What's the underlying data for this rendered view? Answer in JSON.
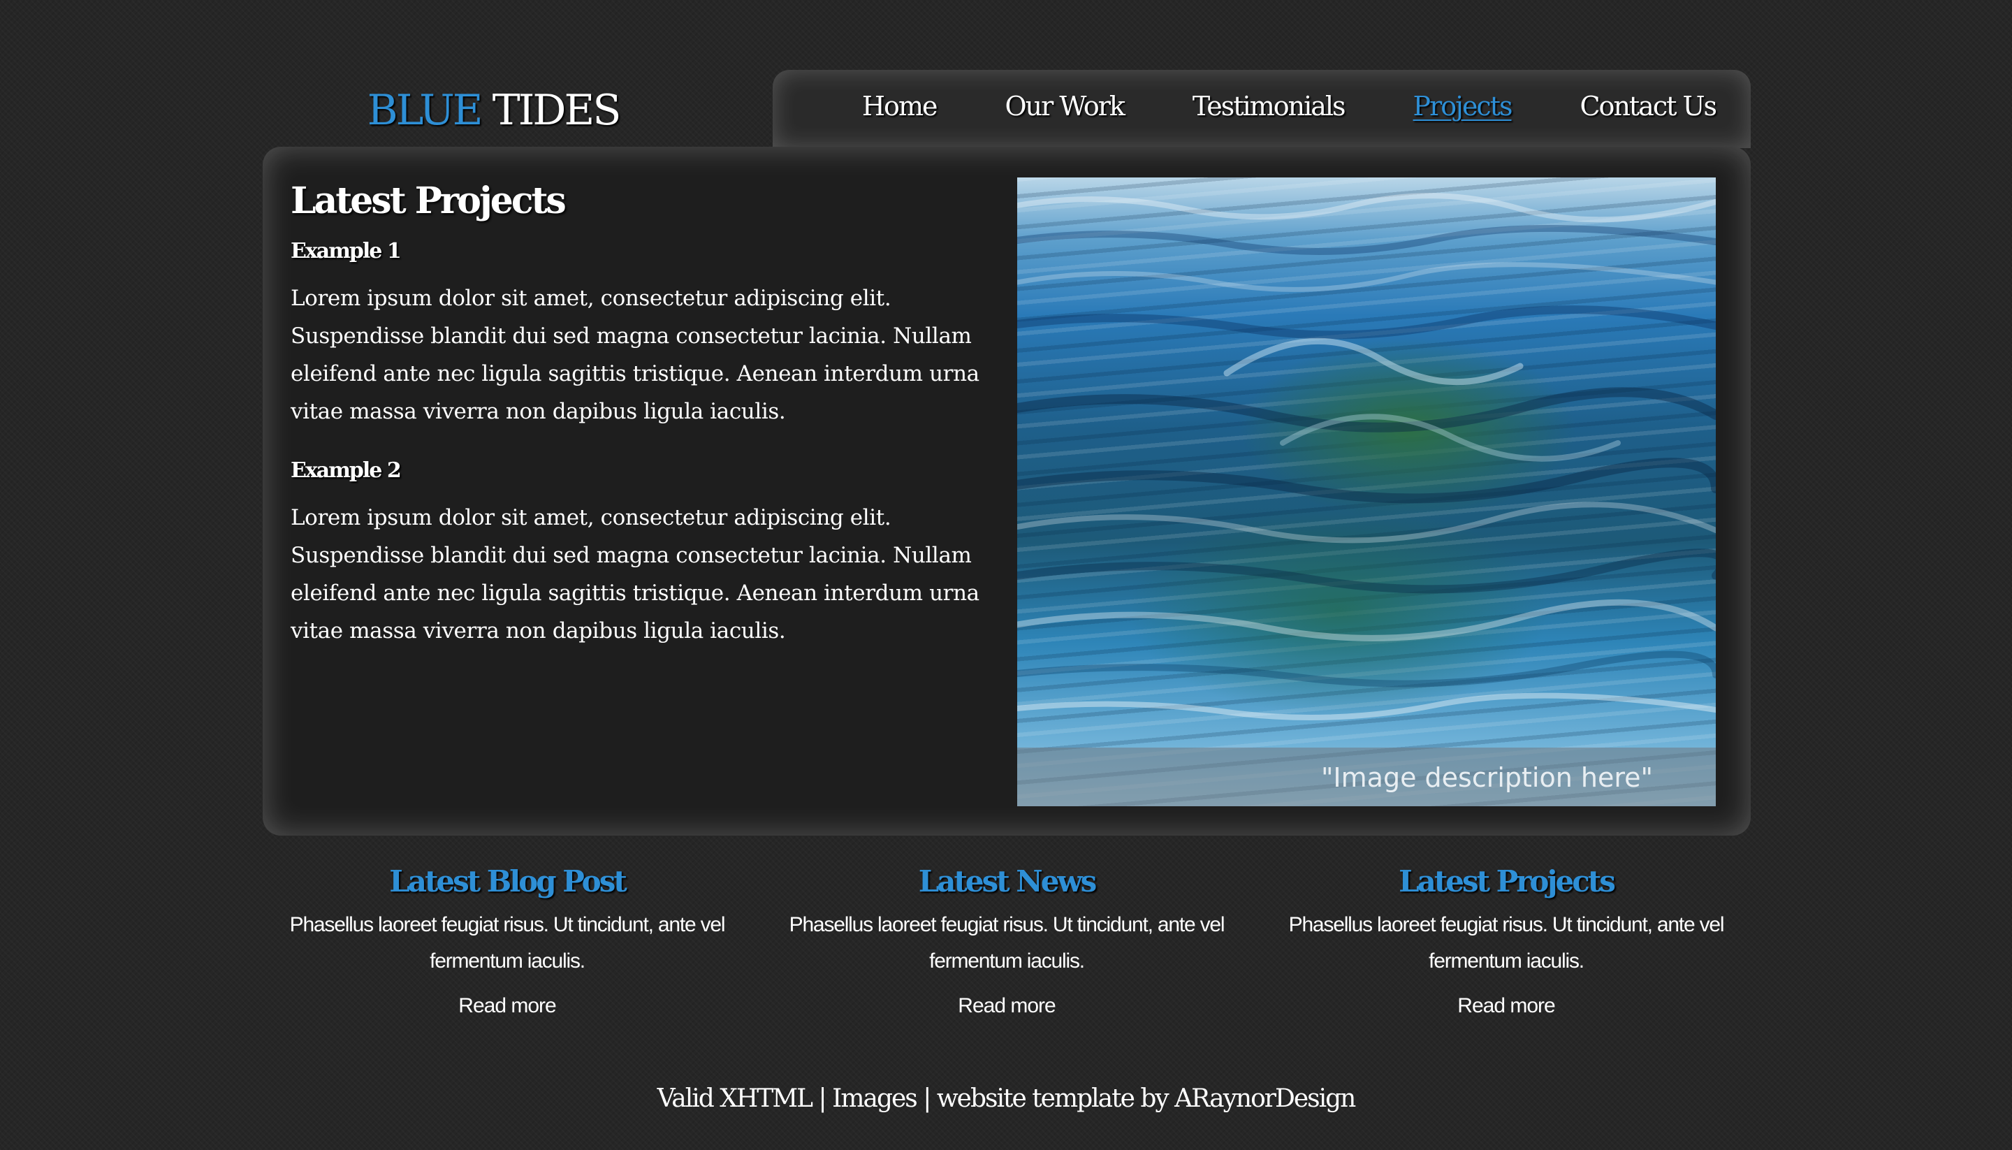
{
  "logo": {
    "part1": "BLUE",
    "part2": "TIDES"
  },
  "nav": {
    "items": [
      {
        "label": "Home"
      },
      {
        "label": "Our Work"
      },
      {
        "label": "Testimonials"
      },
      {
        "label": "Projects",
        "active": true
      },
      {
        "label": "Contact Us"
      }
    ]
  },
  "main": {
    "title": "Latest Projects",
    "examples": [
      {
        "heading": "Example 1",
        "text": "Lorem ipsum dolor sit amet, consectetur adipiscing elit. Suspendisse blandit dui sed magna consectetur lacinia. Nullam eleifend ante nec ligula sagittis tristique. Aenean interdum urna vitae massa viverra non dapibus ligula iaculis."
      },
      {
        "heading": "Example 2",
        "text": "Lorem ipsum dolor sit amet, consectetur adipiscing elit. Suspendisse blandit dui sed magna consectetur lacinia. Nullam eleifend ante nec ligula sagittis tristique. Aenean interdum urna vitae massa viverra non dapibus ligula iaculis."
      }
    ],
    "image": {
      "caption": "\"Image description here\""
    }
  },
  "columns": [
    {
      "title": "Latest Blog Post",
      "text": "Phasellus laoreet feugiat risus. Ut tincidunt, ante vel fermentum iaculis.",
      "read_more": "Read more"
    },
    {
      "title": "Latest News",
      "text": "Phasellus laoreet feugiat risus. Ut tincidunt, ante vel fermentum iaculis.",
      "read_more": "Read more"
    },
    {
      "title": "Latest Projects",
      "text": "Phasellus laoreet feugiat risus. Ut tincidunt, ante vel fermentum iaculis.",
      "read_more": "Read more"
    }
  ],
  "footer": {
    "valid_xhtml": "Valid XHTML",
    "separator": "|",
    "images": "Images",
    "credit": "website template by ARaynorDesign"
  },
  "colors": {
    "accent": "#2e8fd6",
    "background": "#262626",
    "panel": "#1e1e1e"
  }
}
